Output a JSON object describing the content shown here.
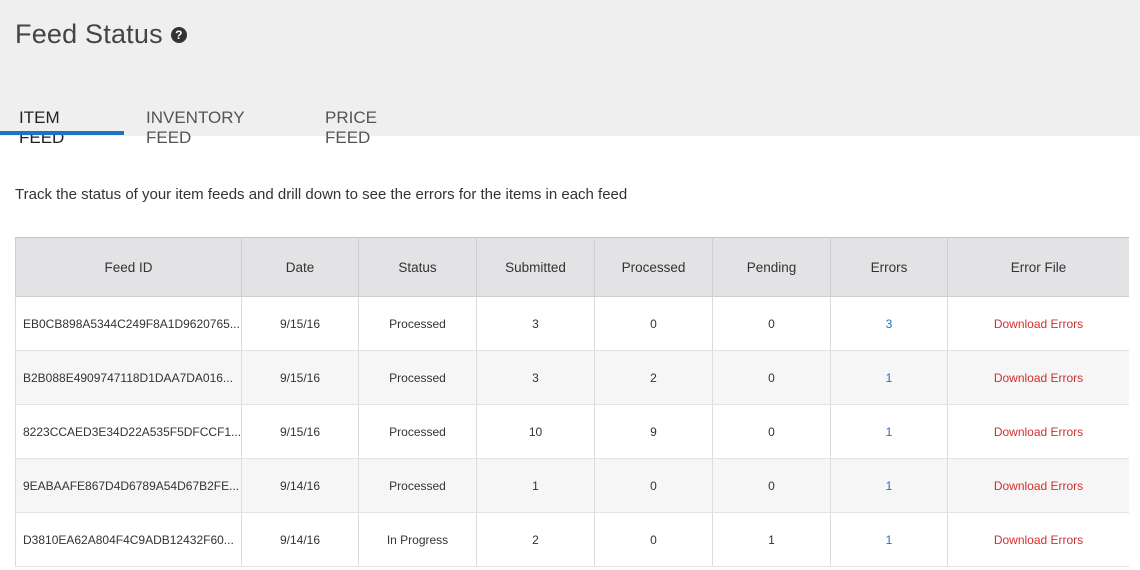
{
  "header": {
    "title": "Feed Status",
    "help_icon": "?"
  },
  "tabs": [
    {
      "label": "ITEM FEED",
      "active": true
    },
    {
      "label": "INVENTORY FEED",
      "active": false
    },
    {
      "label": "PRICE FEED",
      "active": false
    }
  ],
  "description": "Track the status of your item feeds and drill down to see the errors for the items in each feed",
  "table": {
    "columns": [
      "Feed ID",
      "Date",
      "Status",
      "Submitted",
      "Processed",
      "Pending",
      "Errors",
      "Error File"
    ],
    "rows": [
      {
        "feed_id": "EB0CB898A5344C249F8A1D9620765...",
        "date": "9/15/16",
        "status": "Processed",
        "submitted": "3",
        "processed": "0",
        "pending": "0",
        "errors": "3",
        "error_file": "Download Errors"
      },
      {
        "feed_id": "B2B088E4909747118D1DAA7DA016...",
        "date": "9/15/16",
        "status": "Processed",
        "submitted": "3",
        "processed": "2",
        "pending": "0",
        "errors": "1",
        "error_file": "Download Errors"
      },
      {
        "feed_id": "8223CCAED3E34D22A535F5DFCCF1...",
        "date": "9/15/16",
        "status": "Processed",
        "submitted": "10",
        "processed": "9",
        "pending": "0",
        "errors": "1",
        "error_file": "Download Errors"
      },
      {
        "feed_id": "9EABAAFE867D4D6789A54D67B2FE...",
        "date": "9/14/16",
        "status": "Processed",
        "submitted": "1",
        "processed": "0",
        "pending": "0",
        "errors": "1",
        "error_file": "Download Errors"
      },
      {
        "feed_id": "D3810EA62A804F4C9ADB12432F60...",
        "date": "9/14/16",
        "status": "In Progress",
        "submitted": "2",
        "processed": "0",
        "pending": "1",
        "errors": "1",
        "error_file": "Download Errors"
      }
    ]
  },
  "colors": {
    "accent": "#1a73c8",
    "link": "#2a6fb8",
    "error_link": "#d0302f",
    "header_bg": "#efeff0"
  }
}
